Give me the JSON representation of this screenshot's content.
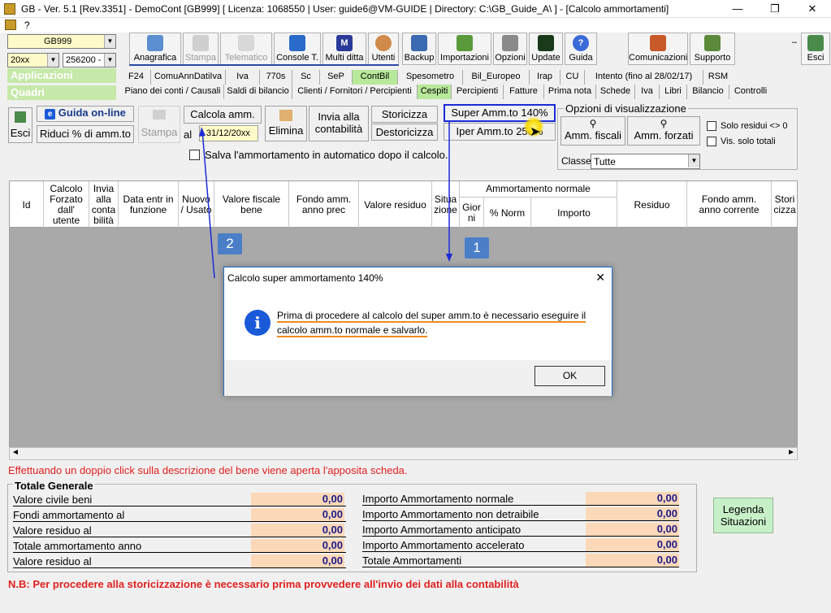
{
  "window": {
    "title": "GB - Ver. 5.1 [Rev.3351] -  DemoCont [GB999]      [ Licenza: 1068550 | User: guide6@VM-GUIDE | Directory: C:\\GB_Guide_A\\ ] - [Calcolo ammortamenti]",
    "menu_help": "?"
  },
  "selectors": {
    "company": "GB999",
    "year": "20xx",
    "account": "256200 -",
    "applicazioni": "Applicazioni",
    "quadri": "Quadri"
  },
  "toolbar": {
    "buttons": [
      {
        "label": "Anagrafica"
      },
      {
        "label": "Stampa"
      },
      {
        "label": "Telematico"
      },
      {
        "label": "Console T."
      },
      {
        "label": "Multi ditta"
      },
      {
        "label": "Utenti"
      },
      {
        "label": "Backup"
      },
      {
        "label": "Importazioni"
      },
      {
        "label": "Opzioni"
      },
      {
        "label": "Update"
      },
      {
        "label": "Guida"
      },
      {
        "label": "Comunicazioni"
      },
      {
        "label": "Supporto"
      },
      {
        "label": "Esci"
      }
    ]
  },
  "tabs_row1": [
    "F24",
    "ComuAnnDatiIva",
    "Iva",
    "770s",
    "Sc",
    "SeP",
    "ContBil",
    "Spesometro",
    "Bil_Europeo",
    "Irap",
    "CU",
    "Intento (fino al 28/02/17)",
    "RSM"
  ],
  "tabs_row2": [
    "Piano dei conti / Causali",
    "Saldi di bilancio",
    "Clienti / Fornitori / Percipienti",
    "Cespiti",
    "Percipienti",
    "Fatture",
    "Prima nota",
    "Schede",
    "Iva",
    "Libri",
    "Bilancio",
    "Controlli"
  ],
  "actions": {
    "esci": "Esci",
    "guida_online": "Guida on-line",
    "riduci": "Riduci % di amm.to",
    "stampa": "Stampa",
    "calcola": "Calcola amm.",
    "al": "al",
    "date": "31/12/20xx",
    "elimina": "Elimina",
    "invia_line1": "Invia alla",
    "invia_line2": "contabilità",
    "storicizza": "Storicizza",
    "destoricizza": "Destoricizza",
    "super": "Super Amm.to 140%",
    "iper": "Iper Amm.to 250%",
    "salva_auto": "Salva l'ammortamento in automatico dopo il calcolo."
  },
  "options": {
    "title": "Opzioni di visualizzazione",
    "amm_fiscali": "Amm. fiscali",
    "amm_forzati": "Amm. forzati",
    "solo_residui": "Solo residui <> 0",
    "vis_totali": "Vis. solo totali",
    "classe_label": "Classe",
    "classe_value": "Tutte"
  },
  "grid": {
    "headers": [
      "Id",
      "Calcolo Forzato dall' utente",
      "Invia alla conta bilità",
      "Data entr in funzione",
      "Nuovo / Usato",
      "Valore fiscale bene",
      "Fondo amm. anno prec",
      "Valore residuo",
      "Situa zione",
      "Ammortamento normale",
      "Gior ni",
      "% Norm",
      "Importo",
      "Residuo",
      "Fondo amm. anno corrente",
      "Stori cizza"
    ]
  },
  "callouts": [
    "1",
    "2"
  ],
  "dialog": {
    "title": "Calcolo super ammortamento 140%",
    "message_line1": "Prima di procedere al calcolo del super amm.to è necessario eseguire il",
    "message_line2": "calcolo amm.to normale e salvarlo.",
    "ok": "OK",
    "close": "✕"
  },
  "hint": "Effettuando un doppio click sulla descrizione del bene viene aperta l'apposita scheda.",
  "totals": {
    "title": "Totale Generale",
    "left": [
      {
        "label": "Valore civile beni",
        "value": "0,00"
      },
      {
        "label": "Fondi ammortamento al",
        "value": "0,00"
      },
      {
        "label": "Valore residuo al",
        "value": "0,00"
      },
      {
        "label": "Totale ammortamento anno",
        "value": "0,00"
      },
      {
        "label": "Valore residuo al",
        "value": "0,00"
      }
    ],
    "right": [
      {
        "label": "Importo Ammortamento normale",
        "value": "0,00"
      },
      {
        "label": "Importo Ammortamento non detraibile",
        "value": "0,00"
      },
      {
        "label": "Importo Ammortamento anticipato",
        "value": "0,00"
      },
      {
        "label": "Importo Ammortamento accelerato",
        "value": "0,00"
      },
      {
        "label": "Totale Ammortamenti",
        "value": "0,00"
      }
    ]
  },
  "legenda": "Legenda Situazioni",
  "note": "N.B: Per procedere alla storicizzazione è necessario prima provvedere all'invio dei dati alla contabilità"
}
